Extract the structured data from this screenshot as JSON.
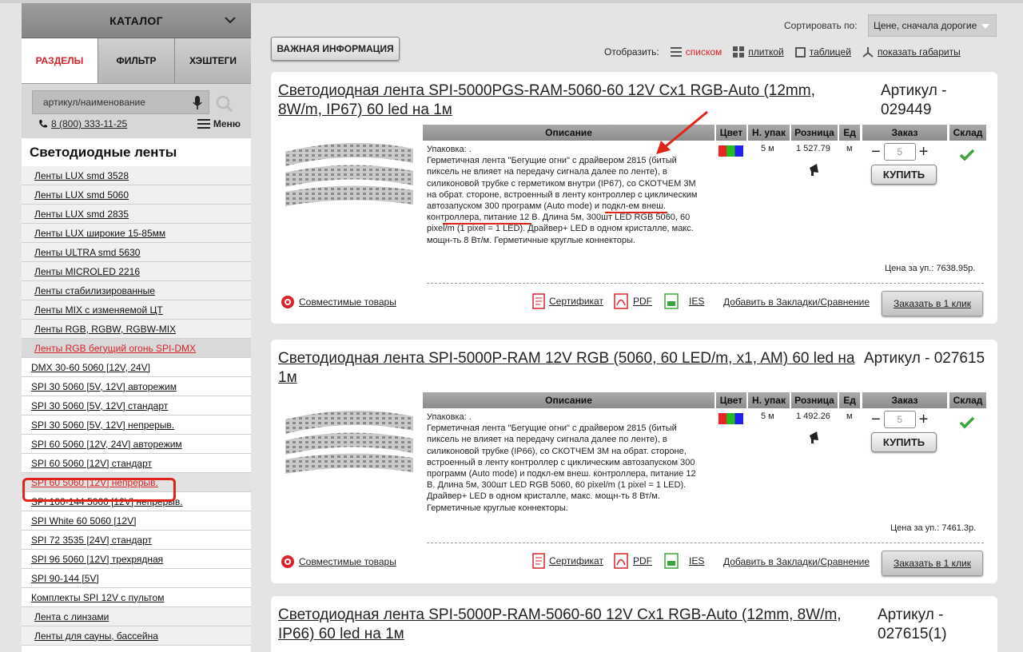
{
  "sidebar": {
    "catalog_title": "КАТАЛОГ",
    "tabs": [
      "РАЗДЕЛЫ",
      "ФИЛЬТР",
      "ХЭШТЕГИ"
    ],
    "search_placeholder": "артикул/наименование",
    "phone": "8 (800) 333-11-25",
    "menu_label": "Меню",
    "section_title": "Светодиодные ленты",
    "items": [
      {
        "label": "Ленты LUX smd 3528"
      },
      {
        "label": "Ленты LUX smd 5060"
      },
      {
        "label": "Ленты LUX smd 2835"
      },
      {
        "label": "Ленты LUX широкие 15-85мм"
      },
      {
        "label": "Ленты ULTRA smd 5630"
      },
      {
        "label": "Ленты MICROLED 2216"
      },
      {
        "label": "Ленты стабилизированные"
      },
      {
        "label": "Ленты MIX с изменяемой ЦТ"
      },
      {
        "label": "Ленты RGB, RGBW, RGBW-MIX"
      },
      {
        "label": "Ленты RGB бегущий огонь SPI-DMX"
      },
      {
        "label": "DMX 30-60 5060 [12V, 24V]"
      },
      {
        "label": "SPI 30 5060 [5V, 12V] авторежим"
      },
      {
        "label": "SPI 30 5060 [5V, 12V] стандарт"
      },
      {
        "label": "SPI 30 5060 [5V, 12V] непрерыв."
      },
      {
        "label": "SPI 60 5060 [12V, 24V] авторежим"
      },
      {
        "label": "SPI 60 5060 [12V] стандарт"
      },
      {
        "label": "SPI 60 5060 [12V] непрерыв."
      },
      {
        "label": "SPI 100-144 5060 [12V] непрерыв."
      },
      {
        "label": "SPI White 60 5060 [12V]"
      },
      {
        "label": "SPI 72 3535 [24V] стандарт"
      },
      {
        "label": "SPI 96 5060 [12V] трехрядная"
      },
      {
        "label": "SPI 90-144 [5V]"
      },
      {
        "label": "Комплекты SPI 12V с пультом"
      },
      {
        "label": "Лента с линзами"
      },
      {
        "label": "Ленты для сауны, бассейна"
      }
    ]
  },
  "toolbar": {
    "sort_label": "Сортировать по:",
    "sort_value": "Цене, сначала дорогие",
    "info_button": "ВАЖНАЯ ИНФОРМАЦИЯ",
    "view_label": "Отобразить:",
    "view_list": "списком",
    "view_tiles": "плиткой",
    "view_table": "таблицей",
    "view_dims": "показать габариты"
  },
  "table_headers": {
    "description": "Описание",
    "color": "Цвет",
    "pack": "Н. упак",
    "retail": "Розница",
    "unit": "Ед",
    "order": "Заказ",
    "stock": "Склад"
  },
  "products": [
    {
      "title": "Светодиодная лента SPI-5000PGS-RAM-5060-60 12V Cx1 RGB-Auto (12mm, 8W/m, IP67) 60 led на 1м",
      "sku": "Артикул - 029449",
      "description": "Упаковка: .\nГерметичная лента \"Бегущие огни\" с драйвером 2815 (битый пиксель не влияет на передачу сигнала далее по ленте), в силиконовой трубке с герметиком внутри (IP67), со СКОТЧЕМ 3М на обрат. стороне, встроенный в ленту контроллер с циклическим автозапуском 300 программ (Auto mode) и подкл-ем внеш. контроллера, питание 12 В. Длина 5м, 300шт LED RGB 5060, 60 pixel/m (1 pixel = 1 LED). Драйвер+ LED в одном кристалле, макс. мощн-ть 8 Вт/м. Герметичные круглые коннекторы.",
      "pack": "5 м",
      "price": "1 527.79",
      "unit": "м",
      "qty": "5",
      "buy": "КУПИТЬ",
      "unit_price": "Цена за уп.: 7638.95р."
    },
    {
      "title": "Светодиодная лента SPI-5000P-RAM 12V RGB (5060, 60 LED/m, x1, AM) 60 led на 1м",
      "sku": "Артикул - 027615",
      "description": "Упаковка: .\nГерметичная лента \"Бегущие огни\" с драйвером 2815 (битый пиксель не влияет на передачу сигнала далее по ленте), в силиконовой трубке (IP66), со СКОТЧЕМ 3М на обрат. стороне, встроенный в ленту контроллер с циклическим автозапуском 300 программ (Auto mode) и подкл-ем внеш. контроллера, питание 12 В. Длина 5м, 300шт LED RGB 5060, 60 pixel/m (1 pixel = 1 LED). Драйвер+ LED в одном кристалле, макс. мощн-ть 8 Вт/м. Герметичные круглые коннекторы.",
      "pack": "5 м",
      "price": "1 492.26",
      "unit": "м",
      "qty": "5",
      "buy": "КУПИТЬ",
      "unit_price": "Цена за уп.: 7461.3р."
    },
    {
      "title": "Светодиодная лента SPI-5000P-RAM-5060-60 12V Cx1 RGB-Auto (12mm, 8W/m, IP66) 60 led на 1м",
      "sku": "Артикул - 027615(1)"
    }
  ],
  "card_footer": {
    "compatible": "Совместимые товары",
    "certificate": "Сертификат",
    "pdf": "PDF",
    "ies": "IES",
    "bookmarks": "Добавить в Закладки/Сравнение",
    "order_one_click": "Заказать в 1 клик"
  },
  "colors": {
    "accent": "#d8232a",
    "stock_check": "#3aa53a",
    "annotation": "#e2231a"
  }
}
